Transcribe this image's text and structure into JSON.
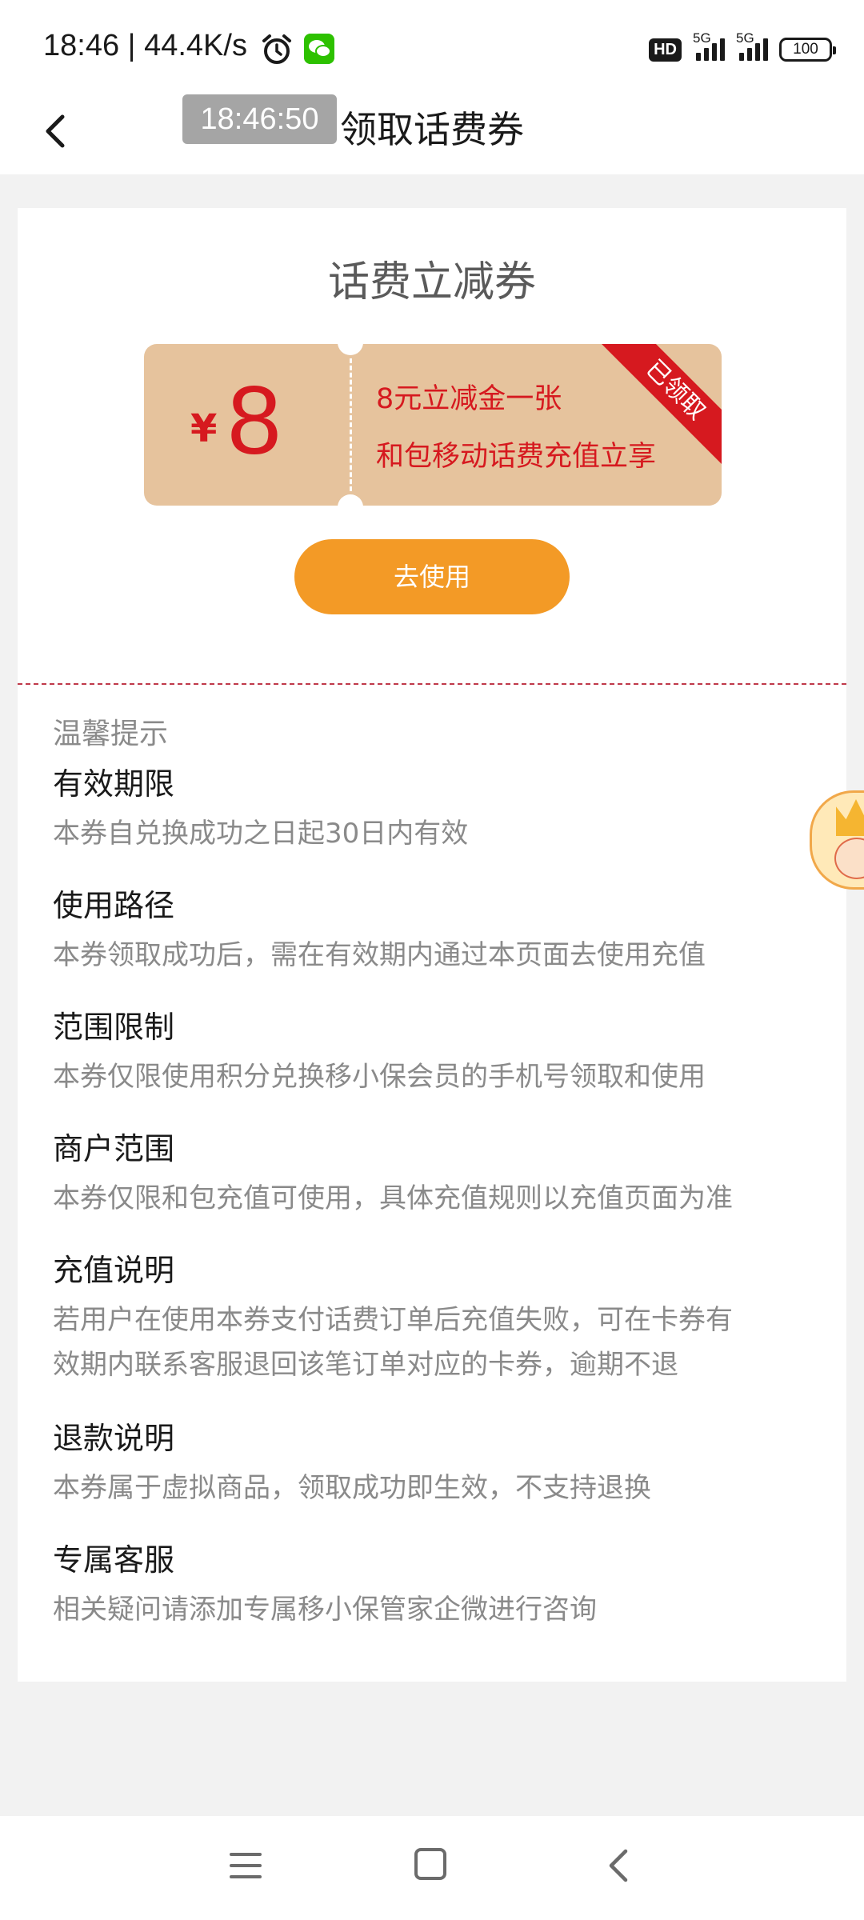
{
  "status_bar": {
    "time": "18:46",
    "speed": "44.4K/s",
    "hd": "HD",
    "net1": "5G",
    "net2": "5G",
    "battery": "100"
  },
  "overlay_time": "18:46:50",
  "header": {
    "title": "领取话费券"
  },
  "card": {
    "title": "话费立减券",
    "coupon": {
      "currency": "¥",
      "amount": "8",
      "line1": "8元立减金一张",
      "line2": "和包移动话费充值立享",
      "ribbon": "已领取"
    },
    "use_button": "去使用",
    "tips_label": "温馨提示",
    "tips": [
      {
        "title": "有效期限",
        "text": "本券自兑换成功之日起30日内有效"
      },
      {
        "title": "使用路径",
        "text": "本券领取成功后，需在有效期内通过本页面去使用充值"
      },
      {
        "title": "范围限制",
        "text": "本券仅限使用积分兑换移小保会员的手机号领取和使用"
      },
      {
        "title": "商户范围",
        "text": "本券仅限和包充值可使用，具体充值规则以充值页面为准"
      },
      {
        "title": "充值说明",
        "text_line1": "若用户在使用本券支付话费订单后充值失败，可在卡券有",
        "text_line2": "效期内联系客服退回该笔订单对应的卡券，逾期不退"
      },
      {
        "title": "退款说明",
        "text": "本券属于虚拟商品，领取成功即生效，不支持退换"
      },
      {
        "title": "专属客服",
        "text": "相关疑问请添加专属移小保管家企微进行咨询"
      }
    ]
  },
  "colors": {
    "accent_orange": "#f39a26",
    "coupon_bg": "#e6c39d",
    "coupon_red": "#d6191f"
  }
}
